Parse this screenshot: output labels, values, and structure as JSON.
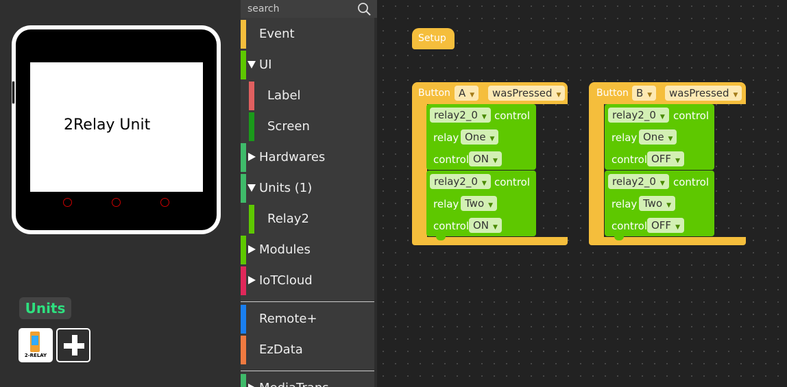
{
  "device": {
    "screen_label": "2Relay Unit"
  },
  "units_panel": {
    "title": "Units",
    "relay_thumb_caption": "2-RELAY"
  },
  "toolbox": {
    "search_placeholder": "search",
    "categories": [
      {
        "label": "Event",
        "color": "#f5be3c"
      },
      {
        "label": "UI",
        "color": "#5ec800",
        "expanded": true
      },
      {
        "label": "Label",
        "color": "#e06060"
      },
      {
        "label": "Screen",
        "color": "#1a9a1a"
      },
      {
        "label": "Hardwares",
        "color": "#3fbb6a",
        "expanded": false
      },
      {
        "label": "Units (1)",
        "color": "#3fbb6a",
        "expanded": true
      },
      {
        "label": "Relay2",
        "color": "#5ec800"
      },
      {
        "label": "Modules",
        "color": "#5ec800",
        "expanded": false
      },
      {
        "label": "IoTCloud",
        "color": "#e0285a",
        "expanded": false
      },
      {
        "label": "Remote+",
        "color": "#1a7ff0"
      },
      {
        "label": "EzData",
        "color": "#f07a40"
      },
      {
        "label": "MediaTrans",
        "color": "#3fbb6a",
        "expanded": false
      }
    ]
  },
  "workspace": {
    "setup_label": "Setup",
    "events": [
      {
        "prefix": "Button",
        "button": "A",
        "action": "wasPressed",
        "blocks": [
          {
            "unit": "relay2_0",
            "control_label": "control",
            "relay_label": "relay",
            "relay": "One",
            "state_label": "control",
            "state": "ON"
          },
          {
            "unit": "relay2_0",
            "control_label": "control",
            "relay_label": "relay",
            "relay": "Two",
            "state_label": "control",
            "state": "ON"
          }
        ]
      },
      {
        "prefix": "Button",
        "button": "B",
        "action": "wasPressed",
        "blocks": [
          {
            "unit": "relay2_0",
            "control_label": "control",
            "relay_label": "relay",
            "relay": "One",
            "state_label": "control",
            "state": "OFF"
          },
          {
            "unit": "relay2_0",
            "control_label": "control",
            "relay_label": "relay",
            "relay": "Two",
            "state_label": "control",
            "state": "OFF"
          }
        ]
      }
    ]
  }
}
